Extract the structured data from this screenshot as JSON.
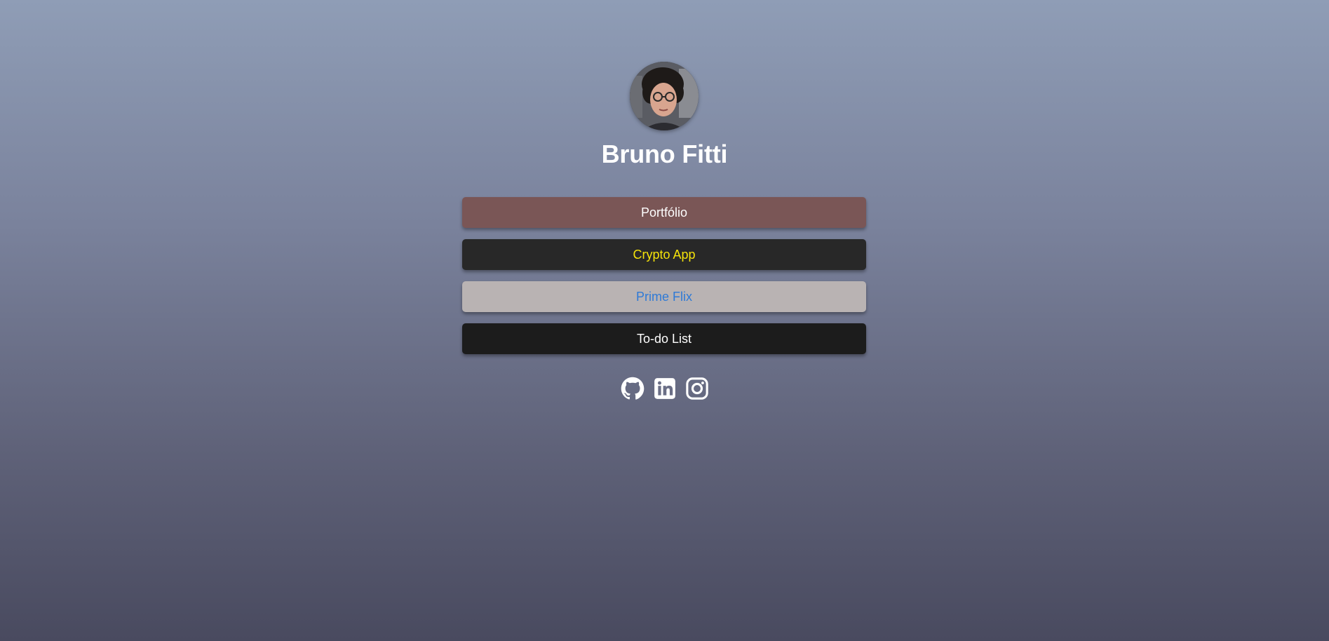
{
  "profile": {
    "name": "Bruno Fitti",
    "avatar_icon": "profile-photo"
  },
  "links": [
    {
      "label": "Portfólio",
      "bg": "#7a5656",
      "color": "#ffffff"
    },
    {
      "label": "Crypto App",
      "bg": "#282828",
      "color": "#f5e30a"
    },
    {
      "label": "Prime Flix",
      "bg": "#b9b3b3",
      "color": "#2f7ad6"
    },
    {
      "label": "To-do List",
      "bg": "#1c1c1c",
      "color": "#ffffff"
    }
  ],
  "socials": [
    {
      "icon": "github-icon"
    },
    {
      "icon": "linkedin-icon"
    },
    {
      "icon": "instagram-icon"
    }
  ],
  "colors": {
    "background_top": "#8f9db6",
    "background_bottom": "#494a5f",
    "text": "#ffffff"
  }
}
